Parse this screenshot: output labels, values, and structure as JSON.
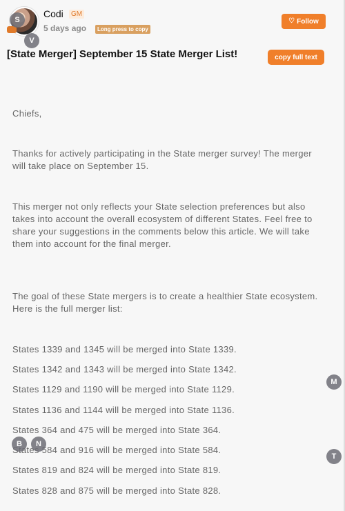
{
  "post": {
    "author": "Codi",
    "role_badge": "GM",
    "time": "5 days ago",
    "long_press_label": "Long press to copy",
    "follow_label": "Follow",
    "title": "[State Merger] September 15 State Merger List!",
    "copy_full_label": "copy full text"
  },
  "avatars": {
    "bubbles": [
      "S",
      "V",
      "M",
      "B",
      "N",
      "T"
    ]
  },
  "content": {
    "greeting": "Chiefs,",
    "thanks": "Thanks for actively participating in the State merger survey! The merger will take place on September 15.",
    "merger_note": "This merger not only reflects your State selection preferences but also takes into account the overall ecosystem of different States. Feel free to share your suggestions in the comments below this article. We will take them into account for the final merger.",
    "goal": "The goal of these State mergers is to create a healthier State ecosystem. Here is the full merger list:",
    "merges": [
      "States 1339 and 1345 will be merged into State 1339.",
      "States 1342 and 1343 will be merged into State 1342.",
      "States 1129 and 1190 will be merged into State 1129.",
      "States 1136 and 1144 will be merged into State 1136.",
      "States 364 and 475 will be merged into State 364.",
      "States 584 and 916 will be merged into State 584.",
      "States 819 and 824 will be merged into State 819.",
      "States 828 and 875 will be merged into State 828."
    ]
  },
  "colors": {
    "accent": "#f07f2a",
    "background": "#f7f7f7",
    "body_text": "#666666",
    "tag": "#d9a060"
  }
}
